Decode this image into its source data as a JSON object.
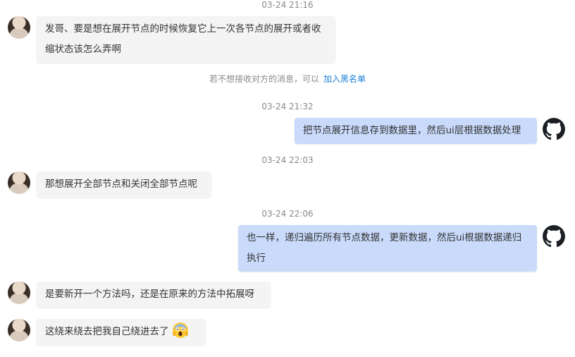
{
  "messages": [
    {
      "timestamp": "03-24 21:16",
      "sender": "peer",
      "text": "发哥、要是想在展开节点的时候恢复它上一次各节点的展开或者收缩状态该怎么弄啊"
    },
    {
      "system_notice": {
        "text": "若不想接收对方的消息，可以",
        "link": "加入黑名单"
      }
    },
    {
      "timestamp": "03-24 21:32",
      "sender": "self",
      "text": "把节点展开信息存到数据里，然后ui层根据数据处理"
    },
    {
      "timestamp": "03-24 22:03",
      "sender": "peer",
      "text": "那想展开全部节点和关闭全部节点呢"
    },
    {
      "timestamp": "03-24 22:06",
      "sender": "self",
      "text": "也一样，递归遍历所有节点数据，更新数据，然后ui根据数据递归执行"
    },
    {
      "sender": "peer",
      "text": "是要新开一个方法吗，还是在原来的方法中拓展呀"
    },
    {
      "sender": "peer",
      "text": "这绕来绕去把我自己绕进去了",
      "emoji": "face-screaming-emoji"
    }
  ],
  "colors": {
    "peer_bubble": "#f4f4f5",
    "self_bubble": "#c9dafb",
    "link": "#1e80d6",
    "timestamp": "#8a8a8a"
  },
  "icons": {
    "self_avatar": "github-icon",
    "peer_avatar": "user-avatar"
  }
}
